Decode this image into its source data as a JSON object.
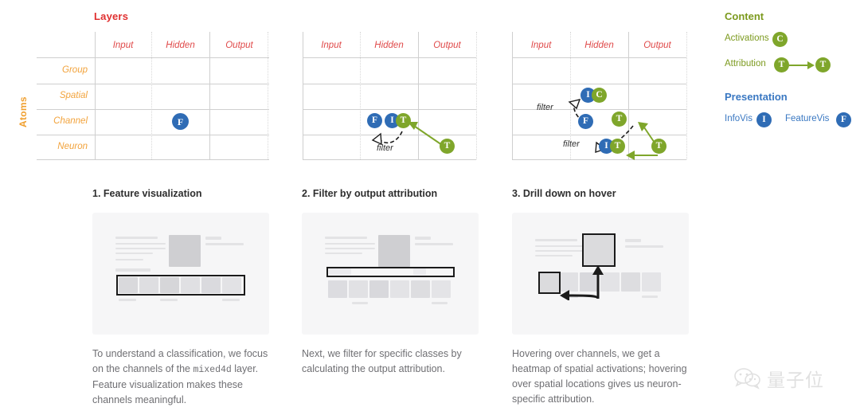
{
  "matrix": {
    "title": "Layers",
    "axis_label": "Atoms",
    "columns": [
      "Input",
      "Hidden",
      "Output"
    ],
    "rows": [
      "Group",
      "Spatial",
      "Channel",
      "Neuron"
    ],
    "filter_label": "filter",
    "nodes": {
      "f": "F",
      "i": "I",
      "t": "T",
      "c": "C"
    }
  },
  "legend": {
    "content_heading": "Content",
    "activations_label": "Activations",
    "activations_token": "C",
    "attribution_label": "Attribution",
    "attribution_token_from": "T",
    "attribution_token_to": "T",
    "presentation_heading": "Presentation",
    "infovis_label": "InfoVis",
    "infovis_token": "I",
    "featurevis_label": "FeatureVis",
    "featurevis_token": "F",
    "colors": {
      "content": "#7c9a1e",
      "presentation": "#3a78c2",
      "node_blue": "#2f6cb5",
      "node_green": "#7fa62b",
      "layers_title": "#e03030",
      "atoms_title": "#f0a030"
    }
  },
  "panels": [
    {
      "title": "1. Feature visualization",
      "text_parts": [
        "To understand a classification, we focus on the channels of the ",
        "mixed4d",
        " layer. Feature visualization makes these channels meaningful."
      ]
    },
    {
      "title": "2. Filter by output attribution",
      "text_parts": [
        "Next, we filter for specific classes by calculating the output attribution.",
        "",
        ""
      ]
    },
    {
      "title": "3. Drill down on hover",
      "text_parts": [
        "Hovering over channels, we get a heatmap of spatial activations; hovering over spatial locations gives us neuron-specific attribution.",
        "",
        ""
      ]
    }
  ],
  "watermark": {
    "text": "量子位"
  }
}
